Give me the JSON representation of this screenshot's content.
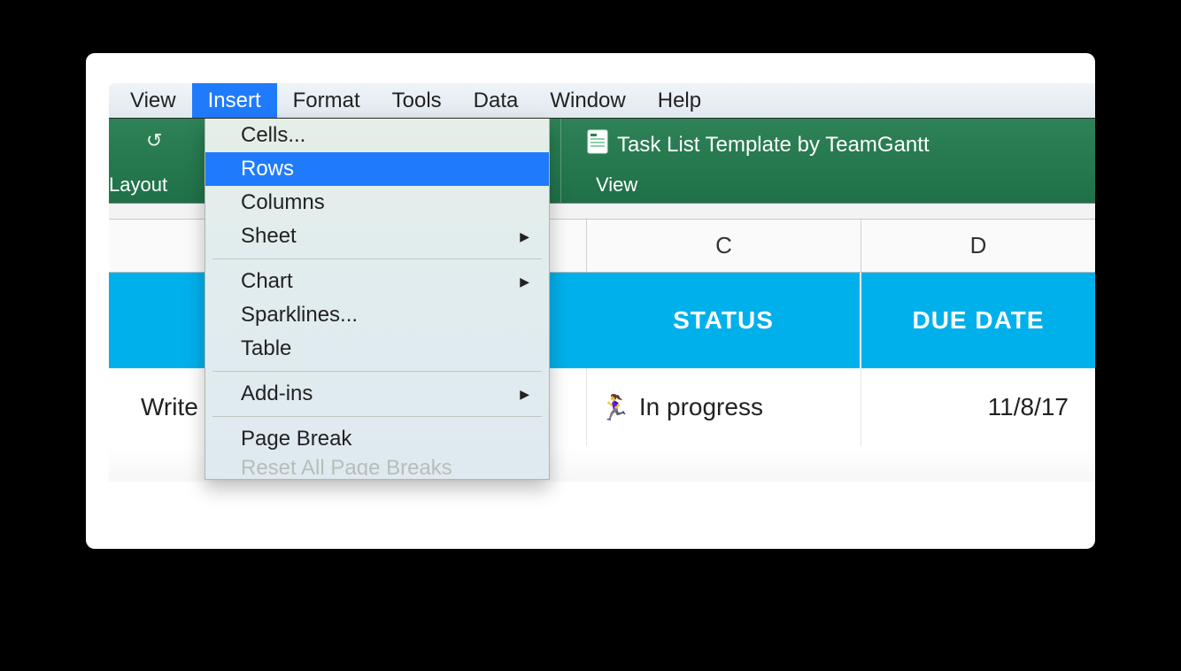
{
  "menubar": {
    "items": [
      "View",
      "Insert",
      "Format",
      "Tools",
      "Data",
      "Window",
      "Help"
    ],
    "active_index": 1
  },
  "ribbon": {
    "layout_label": "Layout",
    "document_title": "Task List Template by TeamGantt",
    "view_tab": "View"
  },
  "columns": {
    "c": "C",
    "d": "D"
  },
  "table_header": {
    "status": "STATUS",
    "due_date": "DUE DATE"
  },
  "row1": {
    "task": "Write",
    "status_icon": "🏃‍♀️",
    "status_text": "In progress",
    "due": "11/8/17"
  },
  "insert_menu": {
    "cells": "Cells...",
    "rows": "Rows",
    "columns": "Columns",
    "sheet": "Sheet",
    "chart": "Chart",
    "sparklines": "Sparklines...",
    "table": "Table",
    "addins": "Add-ins",
    "page_break": "Page Break",
    "reset_breaks": "Reset All Page Breaks"
  }
}
